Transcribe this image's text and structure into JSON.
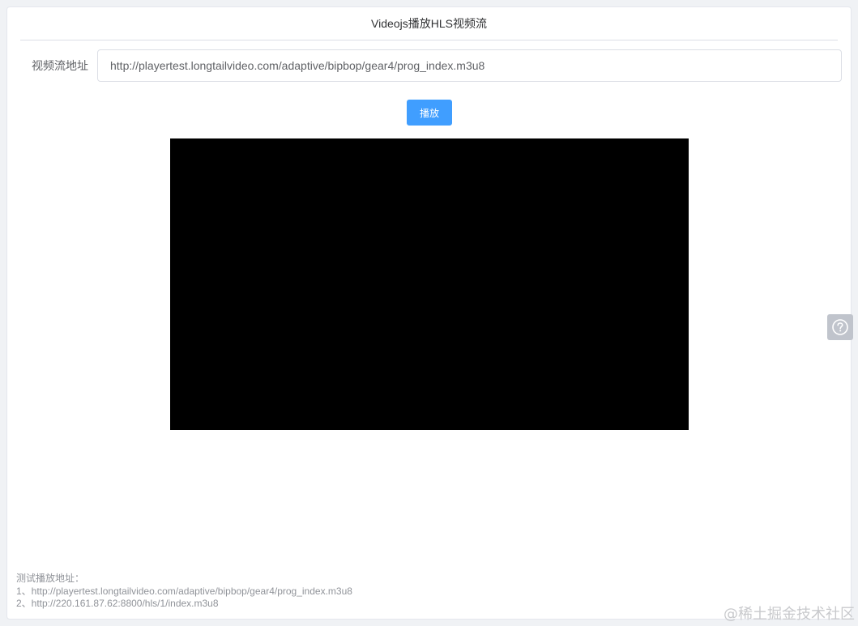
{
  "page": {
    "title": "Videojs播放HLS视频流"
  },
  "form": {
    "url_label": "视频流地址",
    "url_value": "http://playertest.longtailvideo.com/adaptive/bipbop/gear4/prog_index.m3u8",
    "play_label": "播放"
  },
  "notes": {
    "heading": "测试播放地址：",
    "items": [
      "1、http://playertest.longtailvideo.com/adaptive/bipbop/gear4/prog_index.m3u8",
      "2、http://220.161.87.62:8800/hls/1/index.m3u8"
    ]
  },
  "widgets": {
    "help_icon": "question-circle-icon"
  },
  "watermark": {
    "text": "@稀土掘金技术社区"
  },
  "colors": {
    "primary": "#409eff",
    "video_bg": "#000000",
    "help_bg": "#c0c4cc"
  }
}
